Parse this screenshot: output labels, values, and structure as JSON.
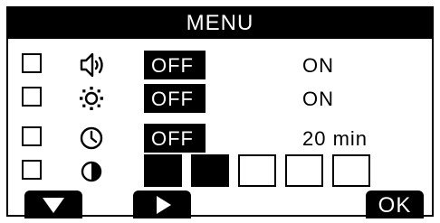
{
  "menu": {
    "title": "MENU",
    "rows": [
      {
        "icon": "speaker-icon",
        "toggle": "OFF",
        "value": "ON"
      },
      {
        "icon": "brightness-icon",
        "toggle": "OFF",
        "value": "ON"
      },
      {
        "icon": "clock-icon",
        "toggle": "OFF",
        "value": "20 min"
      },
      {
        "icon": "contrast-icon",
        "level": 2,
        "level_max": 5
      }
    ]
  },
  "softkeys": {
    "down": "down-arrow-icon",
    "right": "right-arrow-icon",
    "ok_label": "OK"
  }
}
